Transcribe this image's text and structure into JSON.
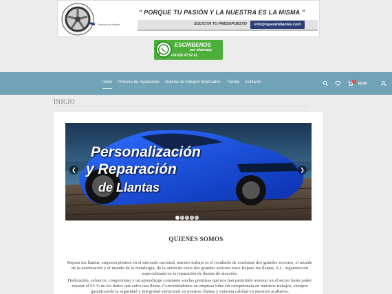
{
  "banner": {
    "slogan": "\" PORQUE TU PASIÓN Y LA NUESTRA ES LA MISMA \"",
    "presupuesto": "SOLICITA TU PRESUPUESTO",
    "email": "info@reparatullantas.com",
    "logo_text": "Repara tus llantas"
  },
  "whatsapp": {
    "title": "ESCRIBENOS",
    "sub": "por whatsapp",
    "phone": "+34 625 47 62 41"
  },
  "nav": {
    "items": [
      "Inicio",
      "Proceso de reparacion",
      "Galeria de trabajos finalizados",
      "Tienda",
      "Contacto"
    ],
    "cart_count": "0",
    "price": "€0,00"
  },
  "page": {
    "breadcrumb": "INICIO",
    "slide": {
      "line1": "Personalización",
      "line2": "y Reparación",
      "line3": "de Llantas"
    },
    "section_title": "QUIENES SOMOS",
    "p1": "Repara tus llantas, empresa pionera en el mercado nacional, nuestro trabajo es el resultado de combinar dos grandes sectores, el mundo de la automoción y el mundo de la metalurgia, de la unión de estos dos grandes sectores nace Repara tus llantas, S.L. organización especializada en la reparación de llantas de aleación.",
    "p2": "Dedicación, esfuerzo, compromiso y un aprendizaje constante son las premisas que nos han permitido avanzar en el sector hasta poder reparar el 95 % de los daños que sufra una llanta. Convirtiéndonos en empresa líder sin competencia en nuestros trabajos, siempre garantizando la seguridad y integridad estructural en nuestras llantas y máxima calidad en nuestros acabados."
  },
  "colors": {
    "nav_bg": "#70a3b6",
    "whatsapp": "#4caf3a",
    "email_btn": "#2a3f73"
  }
}
